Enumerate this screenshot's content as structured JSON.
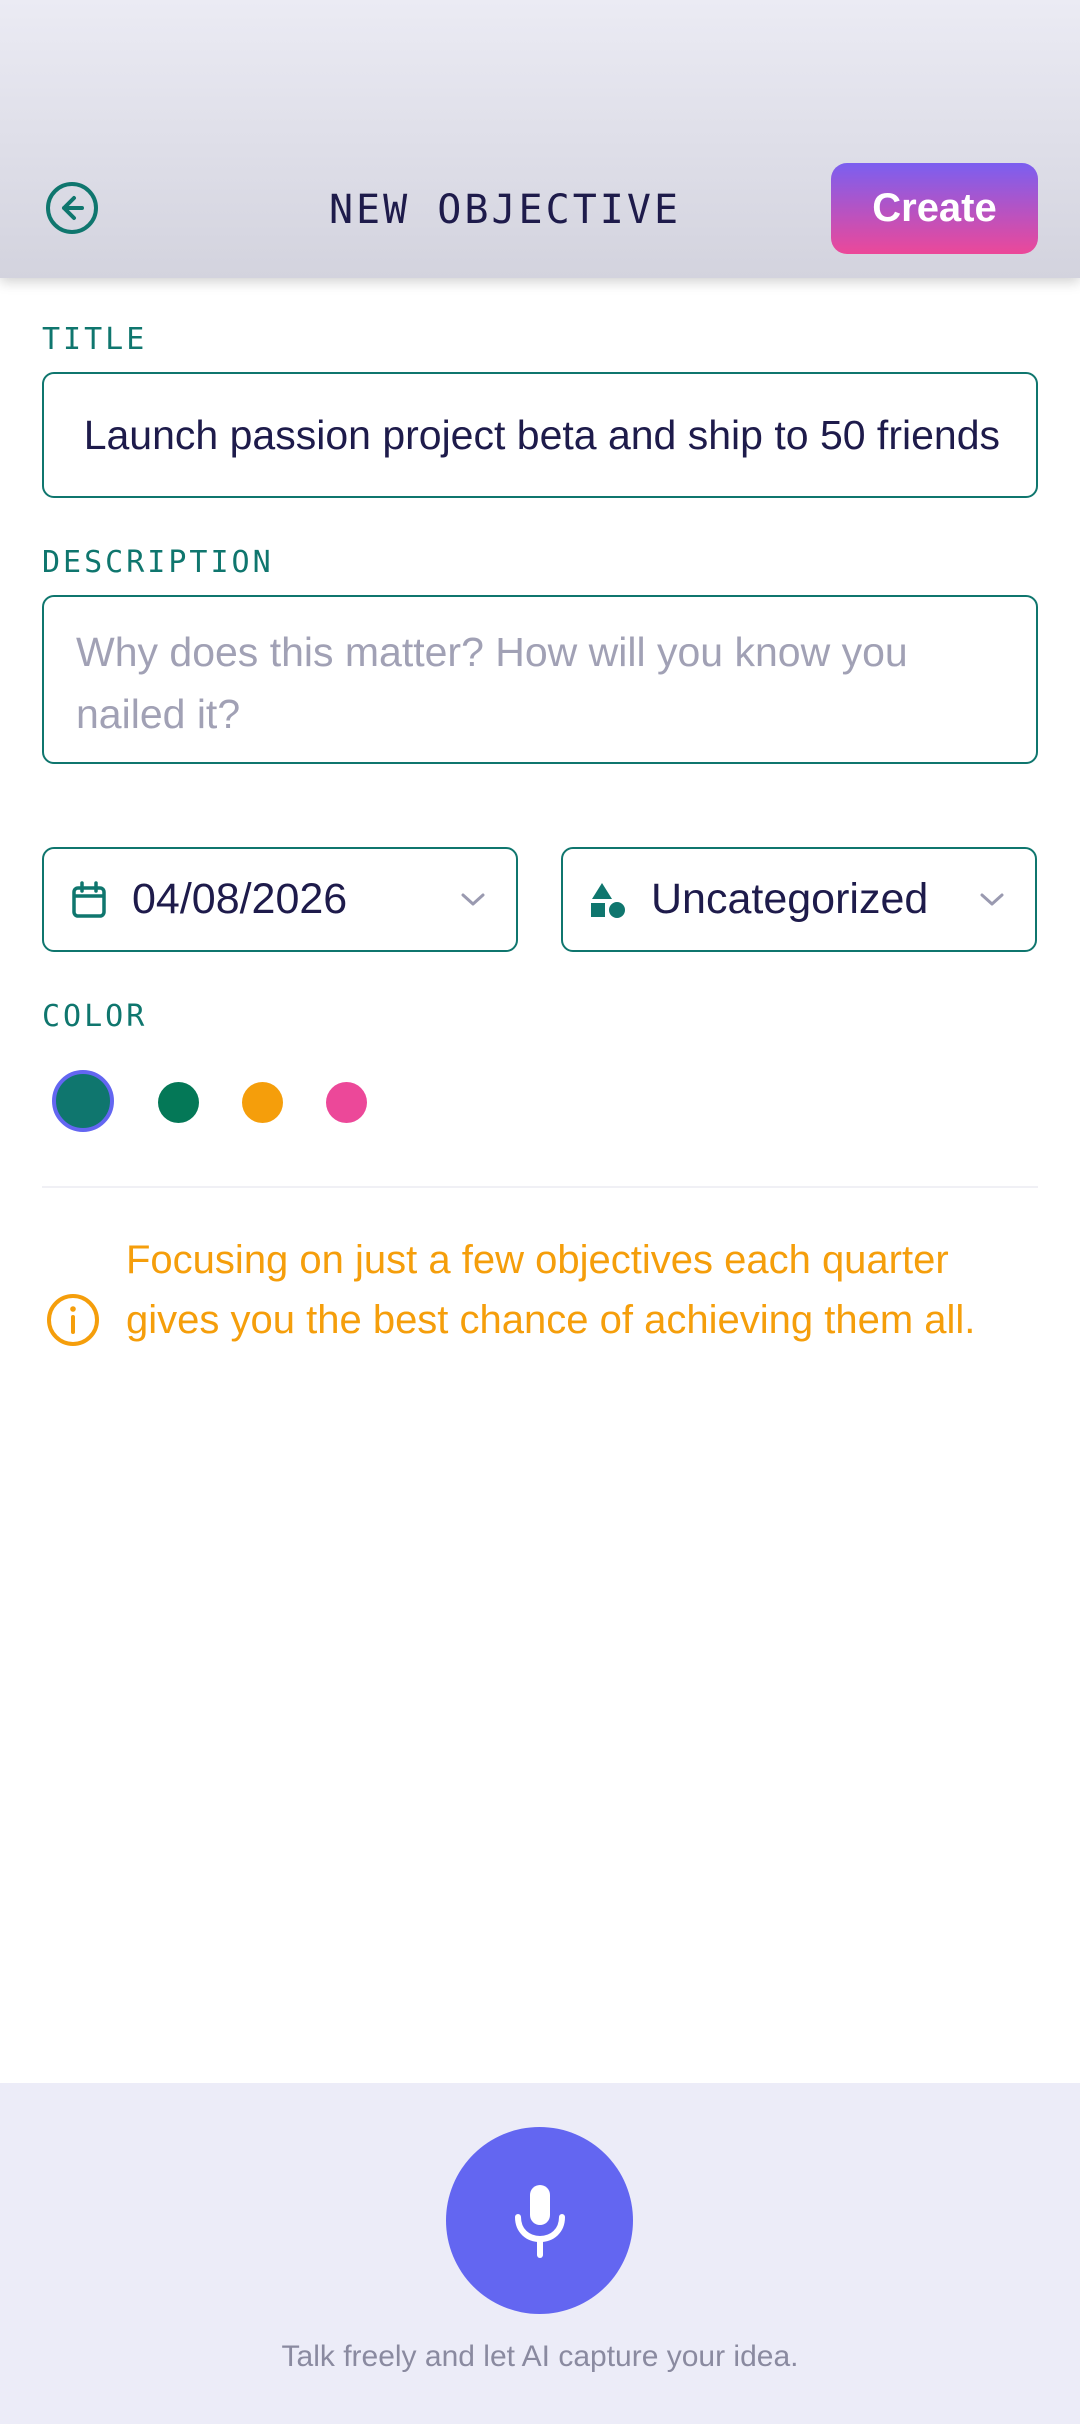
{
  "header": {
    "title": "NEW OBJECTIVE",
    "create_label": "Create",
    "back_icon": "arrow-left-circle-icon"
  },
  "form": {
    "title_label": "TITLE",
    "title_value": "Launch passion project beta and ship to 50 friends",
    "description_label": "DESCRIPTION",
    "description_placeholder": "Why does this matter? How will you know you nailed it?",
    "date_value": "04/08/2026",
    "date_icon": "calendar-icon",
    "category_value": "Uncategorized",
    "category_icon": "shapes-icon",
    "color_label": "COLOR",
    "colors": [
      {
        "name": "teal",
        "hex": "#0f766e",
        "selected": true
      },
      {
        "name": "green",
        "hex": "#047857",
        "selected": false
      },
      {
        "name": "amber",
        "hex": "#f59e0b",
        "selected": false
      },
      {
        "name": "pink",
        "hex": "#ec4899",
        "selected": false
      }
    ]
  },
  "tip": {
    "icon": "info-circle-icon",
    "text": "Focusing on just a few objectives each quarter gives you the best chance of achieving them all."
  },
  "footer": {
    "mic_icon": "microphone-icon",
    "text": "Talk freely and let AI capture your idea."
  },
  "theme": {
    "accent": "#0f766e",
    "primary": "#6366f1",
    "warning": "#f59e0b",
    "create_gradient": [
      "#7b5ff0",
      "#ec4899"
    ]
  }
}
